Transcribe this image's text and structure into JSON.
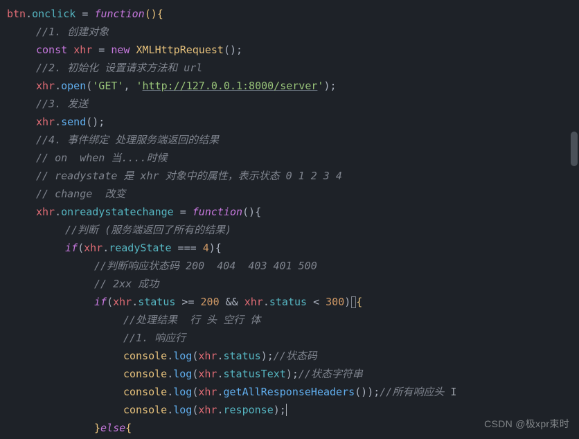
{
  "code": {
    "l0_a": "btn",
    "l0_b": ".",
    "l0_c": "onclick",
    "l0_d": " = ",
    "l0_e": "function",
    "l0_f": "(){",
    "l1": "//1. 创建对象",
    "l2_a": "const",
    "l2_b": " ",
    "l2_c": "xhr",
    "l2_d": " = ",
    "l2_e": "new",
    "l2_f": " ",
    "l2_g": "XMLHttpRequest",
    "l2_h": "();",
    "l3": "//2. 初始化 设置请求方法和 url",
    "l4_a": "xhr",
    "l4_b": ".",
    "l4_c": "open",
    "l4_d": "(",
    "l4_e": "'GET'",
    "l4_f": ", ",
    "l4_g": "'",
    "l4_h": "http://127.0.0.1:8000/server",
    "l4_i": "'",
    "l4_j": ");",
    "l5": "//3. 发送",
    "l6_a": "xhr",
    "l6_b": ".",
    "l6_c": "send",
    "l6_d": "();",
    "l7": "//4. 事件绑定 处理服务端返回的结果",
    "l8": "// on  when 当....时候",
    "l9": "// readystate 是 xhr 对象中的属性，表示状态 0 1 2 3 4",
    "l10": "// change  改变",
    "l11_a": "xhr",
    "l11_b": ".",
    "l11_c": "onreadystatechange",
    "l11_d": " = ",
    "l11_e": "function",
    "l11_f": "(){",
    "l12": "//判断 (服务端返回了所有的结果)",
    "l13_a": "if",
    "l13_b": "(",
    "l13_c": "xhr",
    "l13_d": ".",
    "l13_e": "readyState",
    "l13_f": " === ",
    "l13_g": "4",
    "l13_h": "){",
    "l14": "//判断响应状态码 200  404  403 401 500",
    "l15": "// 2xx 成功",
    "l16_a": "if",
    "l16_b": "(",
    "l16_c": "xhr",
    "l16_d": ".",
    "l16_e": "status",
    "l16_f": " >= ",
    "l16_g": "200",
    "l16_h": " && ",
    "l16_i": "xhr",
    "l16_j": ".",
    "l16_k": "status",
    "l16_l": " < ",
    "l16_m": "300",
    "l16_n": ")",
    "l16_o": "{",
    "l17": "//处理结果  行 头 空行 体",
    "l18": "//1. 响应行",
    "l19_a": "console",
    "l19_b": ".",
    "l19_c": "log",
    "l19_d": "(",
    "l19_e": "xhr",
    "l19_f": ".",
    "l19_g": "status",
    "l19_h": ");",
    "l19_i": "//状态码",
    "l20_a": "console",
    "l20_b": ".",
    "l20_c": "log",
    "l20_d": "(",
    "l20_e": "xhr",
    "l20_f": ".",
    "l20_g": "statusText",
    "l20_h": ");",
    "l20_i": "//状态字符串",
    "l21_a": "console",
    "l21_b": ".",
    "l21_c": "log",
    "l21_d": "(",
    "l21_e": "xhr",
    "l21_f": ".",
    "l21_g": "getAllResponseHeaders",
    "l21_h": "());",
    "l21_i": "//所有响应头",
    "l22_a": "console",
    "l22_b": ".",
    "l22_c": "log",
    "l22_d": "(",
    "l22_e": "xhr",
    "l22_f": ".",
    "l22_g": "response",
    "l22_h": ");",
    "l23_a": "}",
    "l23_b": "else",
    "l23_c": "{"
  },
  "watermark": "CSDN @极xpr束时",
  "cursor_marker": "I"
}
